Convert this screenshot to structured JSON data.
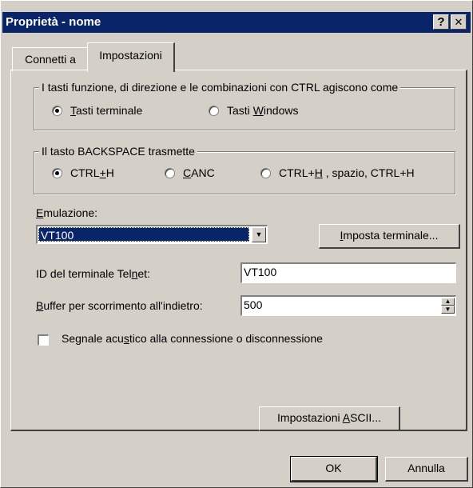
{
  "window": {
    "title": "Proprietà - nome",
    "help_glyph": "?",
    "close_glyph": "✕"
  },
  "tabs": [
    {
      "label": "Connetti a",
      "active": false
    },
    {
      "label": "Impostazioni",
      "active": true
    }
  ],
  "keys_group": {
    "legend": "I tasti funzione, di direzione e le combinazioni con CTRL agiscono come",
    "options": [
      {
        "pre": "",
        "mnemonic": "T",
        "post": "asti terminale",
        "selected": true
      },
      {
        "pre": "Tasti ",
        "mnemonic": "W",
        "post": "indows",
        "selected": false
      }
    ]
  },
  "backspace_group": {
    "legend": "Il tasto BACKSPACE trasmette",
    "options": [
      {
        "pre": "CTRL",
        "mnemonic": "+",
        "post": "H",
        "selected": true
      },
      {
        "pre": "",
        "mnemonic": "C",
        "post": "ANC",
        "selected": false
      },
      {
        "pre": "CTRL+",
        "mnemonic": "H",
        "post": " , spazio, CTRL+H",
        "selected": false
      }
    ]
  },
  "emulation": {
    "label_mnemonic": "E",
    "label_rest": "mulazione:",
    "selected": "VT100",
    "dropdown_glyph": "▼"
  },
  "terminal_settings_button": {
    "mnemonic": "I",
    "rest": "mposta terminale..."
  },
  "telnet_id": {
    "label_pre": "ID del terminale Tel",
    "label_mnemonic": "n",
    "label_post": "et:",
    "value": "VT100"
  },
  "scrollback": {
    "label_mnemonic": "B",
    "label_rest": "uffer per scorrimento all'indietro:",
    "value": "500",
    "up_glyph": "▲",
    "down_glyph": "▼"
  },
  "beep": {
    "label_pre": "Segnale acu",
    "label_mnemonic": "s",
    "label_post": "tico alla connessione o disconnessione",
    "checked": false
  },
  "ascii_button": {
    "pre": "Impostazioni ",
    "mnemonic": "A",
    "post": "SCII..."
  },
  "ok_button": "OK",
  "cancel_button": "Annulla"
}
